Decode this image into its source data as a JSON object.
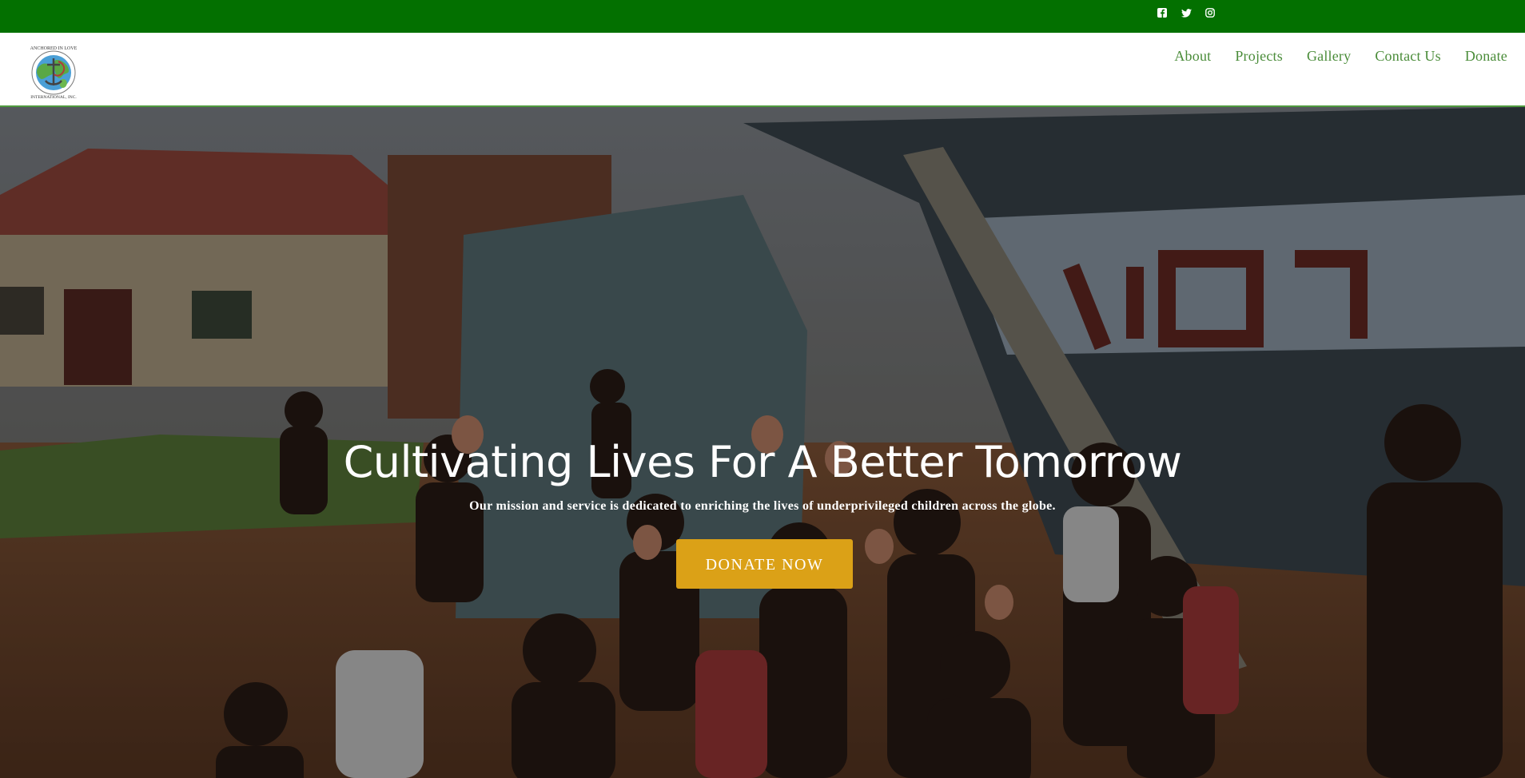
{
  "topbar": {
    "background": "#037000",
    "social": [
      {
        "icon": "facebook-icon",
        "glyph": "f"
      },
      {
        "icon": "twitter-icon",
        "glyph": "🐦"
      },
      {
        "icon": "instagram-icon",
        "glyph": "◎"
      }
    ]
  },
  "header": {
    "logo_alt": "ANCHORED IN LOVE INTERNATIONAL, INC.",
    "nav": [
      {
        "label": "About"
      },
      {
        "label": "Projects"
      },
      {
        "label": "Gallery"
      },
      {
        "label": "Contact Us"
      },
      {
        "label": "Donate"
      }
    ],
    "nav_color": "#4a8c39"
  },
  "hero": {
    "title": "Cultivating Lives For A Better Tomorrow",
    "subtitle": "Our mission and service is dedicated to enriching the lives of underprivileged children across the globe.",
    "cta_label": "DONATE NOW",
    "cta_color": "#dba117"
  }
}
